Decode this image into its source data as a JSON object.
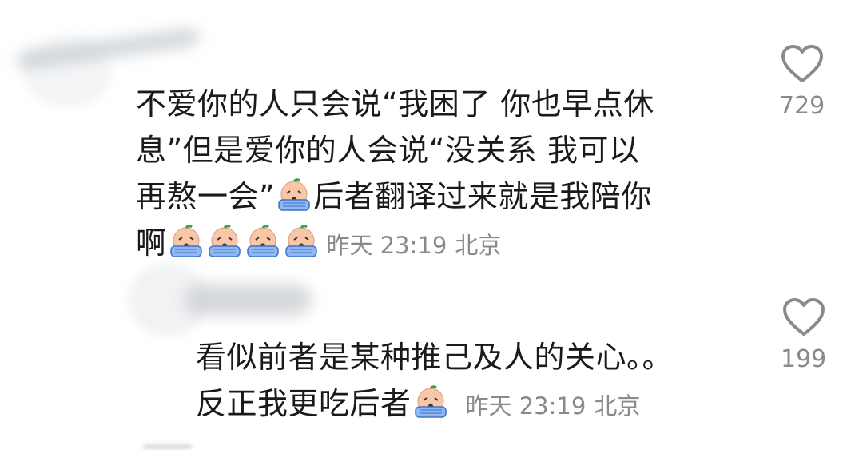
{
  "comments": [
    {
      "text_line1": "不爱你的人只会说“我困了 你也早点休",
      "text_line2": "息”但是爱你的人会说“没关系 我可以",
      "text_line3a": "再熬一会”",
      "text_line3b": "后者翻译过来就是我陪你",
      "text_line4": "啊",
      "time": "昨天 23:19",
      "location": "北京",
      "likes": "729",
      "emoji": "crying-face-sticker"
    },
    {
      "text_line1": "看似前者是某种推己及人的关心。。",
      "text_line2": "反正我更吃后者",
      "time": "昨天 23:19",
      "location": "北京",
      "likes": "199",
      "emoji": "crying-face-sticker"
    }
  ],
  "colors": {
    "text": "#1a1a1a",
    "meta": "#8a8a8a",
    "icon": "#8a8a8a"
  }
}
